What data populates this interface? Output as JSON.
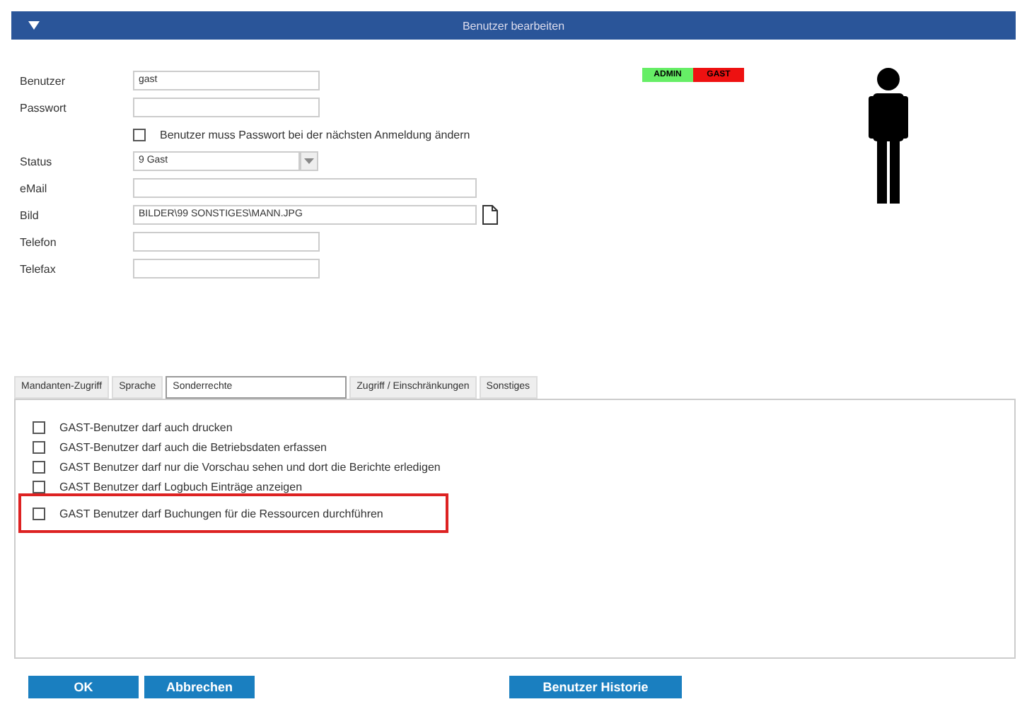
{
  "window": {
    "title": "Benutzer bearbeiten"
  },
  "form": {
    "fields": [
      {
        "kind": "text",
        "label": "Benutzer",
        "value": "gast"
      },
      {
        "kind": "text",
        "label": "Passwort"
      },
      {
        "kind": "checkbox",
        "label": "Benutzer muss Passwort bei der nächsten Anmeldung ändern",
        "checked": false
      },
      {
        "kind": "select",
        "label": "Status",
        "value": "9 Gast"
      },
      {
        "kind": "longtext",
        "label": "eMail"
      },
      {
        "kind": "file",
        "label": "Bild",
        "value": "BILDER\\99 SONSTIGES\\MANN.JPG"
      },
      {
        "kind": "text",
        "label": "Telefon"
      },
      {
        "kind": "text",
        "label": "Telefax"
      }
    ]
  },
  "badges": [
    {
      "label": "ADMIN",
      "color": "#66ee66"
    },
    {
      "label": "GAST",
      "color": "#ee1111"
    }
  ],
  "tabs": [
    {
      "label": "Mandanten-Zugriff",
      "selected": false
    },
    {
      "label": "Sprache",
      "selected": false
    },
    {
      "label": "Sonderrechte",
      "selected": true
    },
    {
      "label": "Zugriff / Einschränkungen",
      "selected": false
    },
    {
      "label": "Sonstiges",
      "selected": false
    }
  ],
  "permissions": [
    {
      "label": "GAST-Benutzer darf auch drucken",
      "checked": false,
      "highlighted": false
    },
    {
      "label": "GAST-Benutzer darf auch die Betriebsdaten erfassen",
      "checked": false,
      "highlighted": false
    },
    {
      "label": "GAST Benutzer darf nur die Vorschau sehen und dort die Berichte erledigen",
      "checked": false,
      "highlighted": false
    },
    {
      "label": "GAST Benutzer darf Logbuch Einträge anzeigen",
      "checked": false,
      "highlighted": false
    },
    {
      "label": "GAST Benutzer darf Buchungen für die Ressourcen durchführen",
      "checked": false,
      "highlighted": true
    }
  ],
  "buttons": {
    "left": [
      "OK",
      "Abbrechen"
    ],
    "right": [
      "Benutzer Historie"
    ]
  }
}
